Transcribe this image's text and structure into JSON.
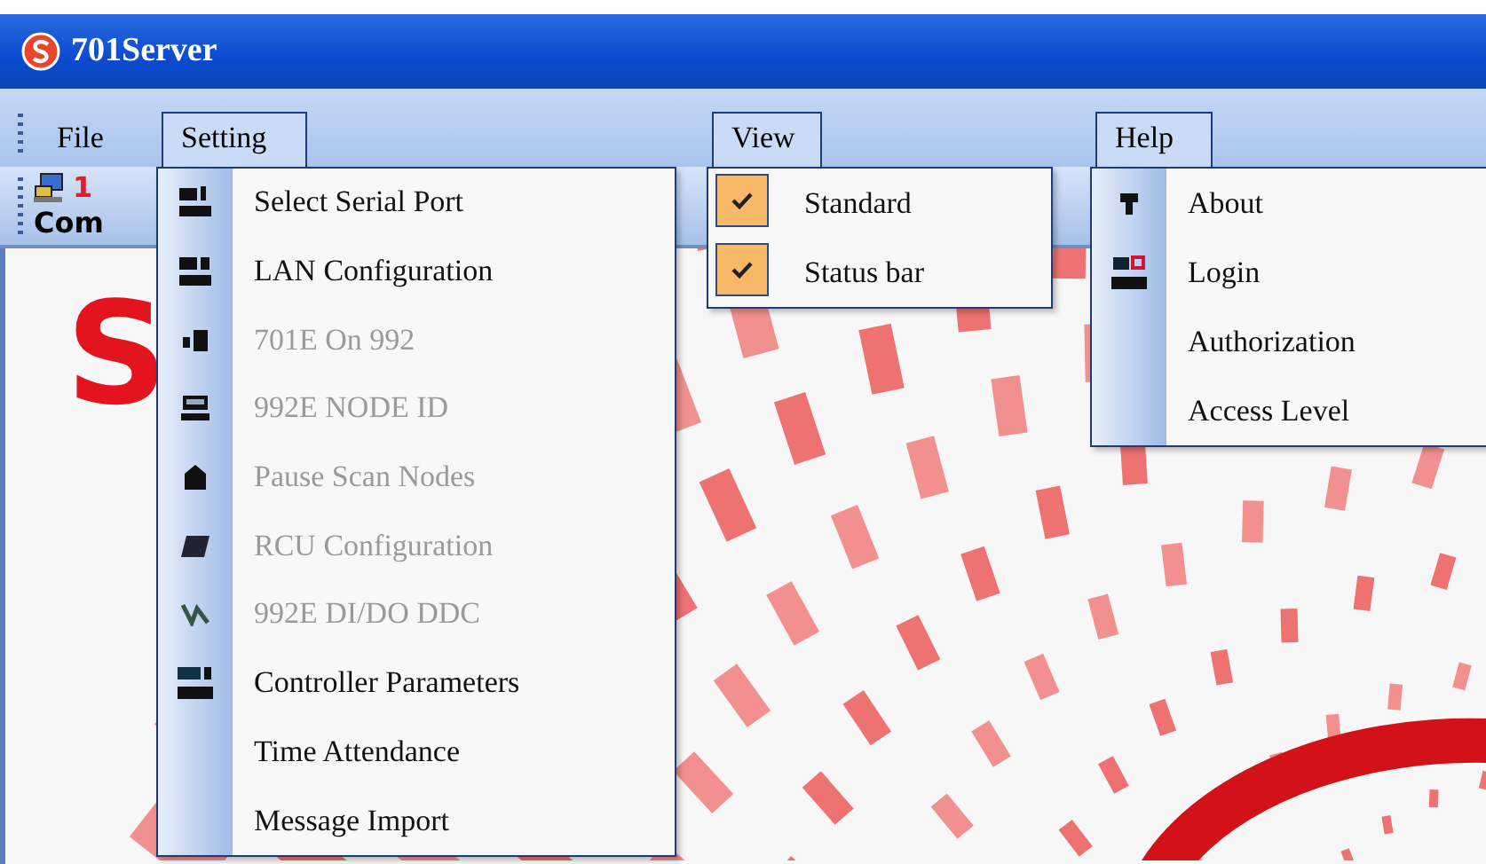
{
  "window": {
    "title": "701Server"
  },
  "menu_bar": [
    {
      "label": "File",
      "selected": false
    },
    {
      "label": "Setting",
      "selected": true
    },
    {
      "label": "View",
      "selected": true
    },
    {
      "label": "Help",
      "selected": true
    }
  ],
  "toolbar": [
    {
      "number": "1",
      "label": "Com"
    }
  ],
  "splash": {
    "logo_text": "S"
  },
  "setting_menu": [
    {
      "label": "Select Serial Port",
      "disabled": false
    },
    {
      "label": "LAN Configuration",
      "disabled": false
    },
    {
      "label": "701E On 992",
      "disabled": true
    },
    {
      "label": "992E NODE ID",
      "disabled": true
    },
    {
      "label": "Pause Scan Nodes",
      "disabled": true
    },
    {
      "label": "RCU Configuration",
      "disabled": true
    },
    {
      "label": "992E DI/DO DDC",
      "disabled": true
    },
    {
      "label": "Controller Parameters",
      "disabled": false
    },
    {
      "label": "Time Attendance",
      "disabled": false
    },
    {
      "label": "Message Import",
      "disabled": false
    }
  ],
  "view_menu": [
    {
      "label": "Standard",
      "checked": true
    },
    {
      "label": "Status bar",
      "checked": true
    }
  ],
  "help_menu": [
    {
      "label": "About"
    },
    {
      "label": "Login"
    },
    {
      "label": "Authorization"
    },
    {
      "label": "Access Level"
    }
  ]
}
